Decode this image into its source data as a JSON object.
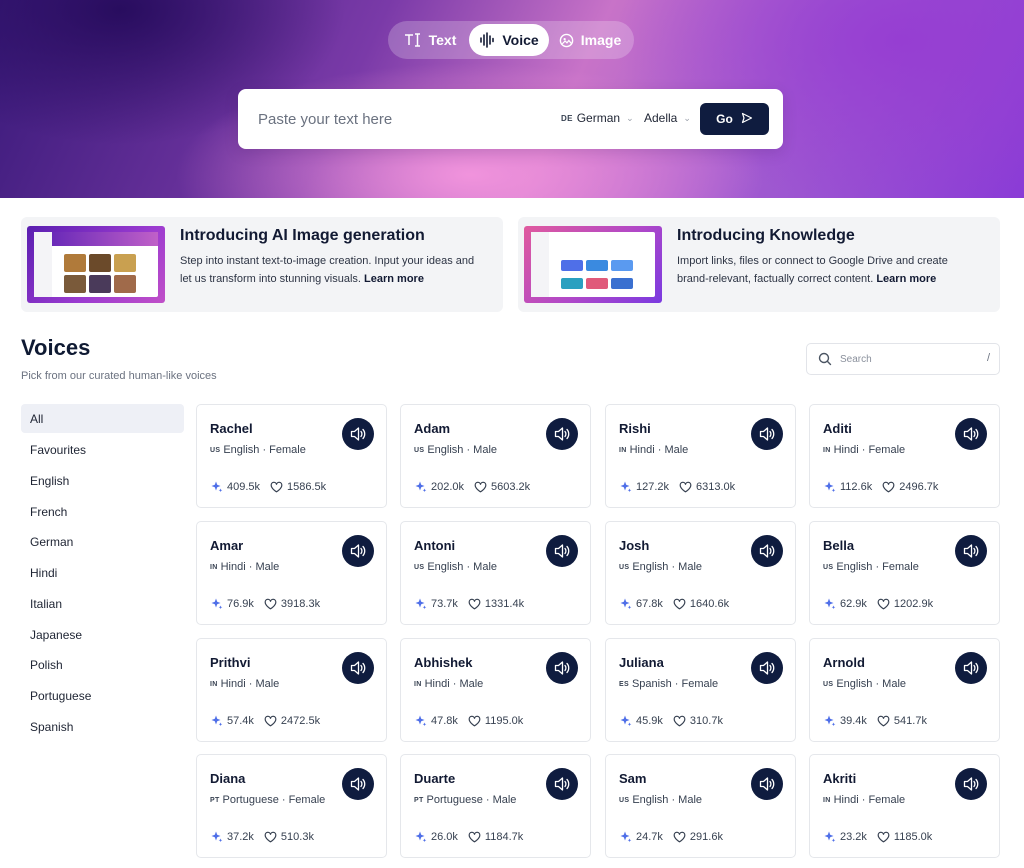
{
  "mode_tabs": [
    {
      "label": "Text",
      "icon": "text-cursor-icon"
    },
    {
      "label": "Voice",
      "icon": "waveform-icon"
    },
    {
      "label": "Image",
      "icon": "image-icon"
    }
  ],
  "search_bar": {
    "placeholder": "Paste your text here",
    "language_code": "DE",
    "language": "German",
    "voice": "Adella",
    "go_label": "Go"
  },
  "promos": [
    {
      "title": "Introducing AI Image generation",
      "text": "Step into instant text-to-image creation. Input your ideas and let us transform into stunning visuals. ",
      "link": "Learn more"
    },
    {
      "title": "Introducing Knowledge",
      "text": "Import links, files or connect to Google Drive and create brand-relevant, factually correct content. ",
      "link": "Learn more"
    }
  ],
  "voices": {
    "title": "Voices",
    "subtitle": "Pick from our curated human-like voices",
    "search_placeholder": "Search",
    "search_shortcut": "/"
  },
  "sidebar": {
    "items": [
      "All",
      "Favourites",
      "English",
      "French",
      "German",
      "Hindi",
      "Italian",
      "Japanese",
      "Polish",
      "Portuguese",
      "Spanish"
    ],
    "active": "All"
  },
  "cards": [
    {
      "name": "Rachel",
      "cc": "US",
      "lang": "English · Female",
      "uses": "409.5k",
      "likes": "1586.5k"
    },
    {
      "name": "Adam",
      "cc": "US",
      "lang": "English · Male",
      "uses": "202.0k",
      "likes": "5603.2k"
    },
    {
      "name": "Rishi",
      "cc": "IN",
      "lang": "Hindi · Male",
      "uses": "127.2k",
      "likes": "6313.0k"
    },
    {
      "name": "Aditi",
      "cc": "IN",
      "lang": "Hindi · Female",
      "uses": "112.6k",
      "likes": "2496.7k"
    },
    {
      "name": "Amar",
      "cc": "IN",
      "lang": "Hindi · Male",
      "uses": "76.9k",
      "likes": "3918.3k"
    },
    {
      "name": "Antoni",
      "cc": "US",
      "lang": "English · Male",
      "uses": "73.7k",
      "likes": "1331.4k"
    },
    {
      "name": "Josh",
      "cc": "US",
      "lang": "English · Male",
      "uses": "67.8k",
      "likes": "1640.6k"
    },
    {
      "name": "Bella",
      "cc": "US",
      "lang": "English · Female",
      "uses": "62.9k",
      "likes": "1202.9k"
    },
    {
      "name": "Prithvi",
      "cc": "IN",
      "lang": "Hindi · Male",
      "uses": "57.4k",
      "likes": "2472.5k"
    },
    {
      "name": "Abhishek",
      "cc": "IN",
      "lang": "Hindi · Male",
      "uses": "47.8k",
      "likes": "1195.0k"
    },
    {
      "name": "Juliana",
      "cc": "ES",
      "lang": "Spanish · Female",
      "uses": "45.9k",
      "likes": "310.7k"
    },
    {
      "name": "Arnold",
      "cc": "US",
      "lang": "English · Male",
      "uses": "39.4k",
      "likes": "541.7k"
    },
    {
      "name": "Diana",
      "cc": "PT",
      "lang": "Portuguese · Female",
      "uses": "37.2k",
      "likes": "510.3k"
    },
    {
      "name": "Duarte",
      "cc": "PT",
      "lang": "Portuguese · Male",
      "uses": "26.0k",
      "likes": "1184.7k"
    },
    {
      "name": "Sam",
      "cc": "US",
      "lang": "English · Male",
      "uses": "24.7k",
      "likes": "291.6k"
    },
    {
      "name": "Akriti",
      "cc": "IN",
      "lang": "Hindi · Female",
      "uses": "23.2k",
      "likes": "1185.0k"
    }
  ],
  "colors": {
    "primary_dark": "#0f1c3f",
    "sparkle_blue": "#4f6fe8",
    "sidebar_active_bg": "#eef0f6"
  }
}
